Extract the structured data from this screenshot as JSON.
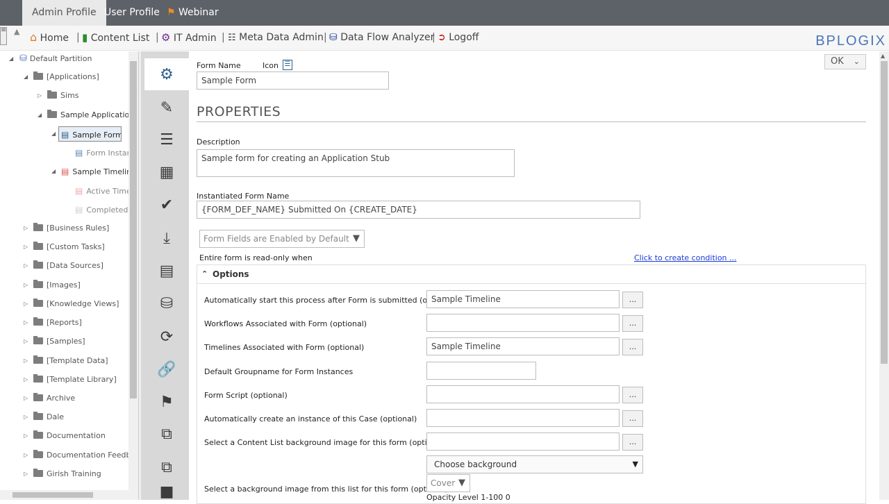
{
  "topbar": {
    "tabs": [
      {
        "label": "Admin Profile"
      },
      {
        "label": "User Profile"
      },
      {
        "label": "Webinar"
      }
    ]
  },
  "nav": {
    "items": [
      {
        "label": "Home",
        "icon": "home-icon"
      },
      {
        "label": "Content List",
        "icon": "folder-open-icon"
      },
      {
        "label": "IT Admin",
        "icon": "gear-icon"
      },
      {
        "label": "Meta Data Admin",
        "icon": "hierarchy-icon"
      },
      {
        "label": "Data Flow Analyzer",
        "icon": "database-icon"
      },
      {
        "label": "Logoff",
        "icon": "logoff-icon"
      }
    ],
    "logo": "BPLOGIX"
  },
  "tree": {
    "items": [
      {
        "label": "Default Partition"
      },
      {
        "label": "[Applications]"
      },
      {
        "label": "Sims"
      },
      {
        "label": "Sample Application"
      },
      {
        "label": "Sample Form"
      },
      {
        "label": "Form Instar"
      },
      {
        "label": "Sample Timeline"
      },
      {
        "label": "Active Time"
      },
      {
        "label": "Completed"
      },
      {
        "label": "[Business Rules]"
      },
      {
        "label": "[Custom Tasks]"
      },
      {
        "label": "[Data Sources]"
      },
      {
        "label": "[Images]"
      },
      {
        "label": "[Knowledge Views]"
      },
      {
        "label": "[Reports]"
      },
      {
        "label": "[Samples]"
      },
      {
        "label": "[Template Data]"
      },
      {
        "label": "[Template Library]"
      },
      {
        "label": "Archive"
      },
      {
        "label": "Dale"
      },
      {
        "label": "Documentation"
      },
      {
        "label": "Documentation Feedba"
      },
      {
        "label": "Girish Training"
      }
    ]
  },
  "form": {
    "ok_label": "OK",
    "form_name_label": "Form Name",
    "icon_label": "Icon",
    "form_name_value": "Sample Form",
    "section_title": "PROPERTIES",
    "description_label": "Description",
    "description_value": "Sample form for creating an Application Stub",
    "inst_name_label": "Instantiated Form Name",
    "inst_name_value": "{FORM_DEF_NAME} Submitted On {CREATE_DATE}",
    "fields_enabled_value": "Form Fields are Enabled by Default",
    "readonly_label": "Entire form is read-only when",
    "condition_link": "Click to create condition ...",
    "options_title": "Options",
    "rows": [
      {
        "label": "Automatically start this process after Form is submitted (optional)",
        "value": "Sample Timeline"
      },
      {
        "label": "Workflows Associated with Form (optional)",
        "value": ""
      },
      {
        "label": "Timelines Associated with Form (optional)",
        "value": "Sample Timeline"
      },
      {
        "label": "Default Groupname for Form Instances",
        "value": ""
      },
      {
        "label": "Form Script (optional)",
        "value": ""
      },
      {
        "label": "Automatically create an instance of this Case (optional)",
        "value": ""
      },
      {
        "label": "Select a Content List background image for this form (optional)",
        "value": ""
      }
    ],
    "bg_select_label": "Select a background image from this list for this form (optional)",
    "choose_bg_value": "Choose background",
    "cover_value": "Cover",
    "opacity_label": "Opacity Level 1-100 0",
    "ellipsis": "..."
  }
}
